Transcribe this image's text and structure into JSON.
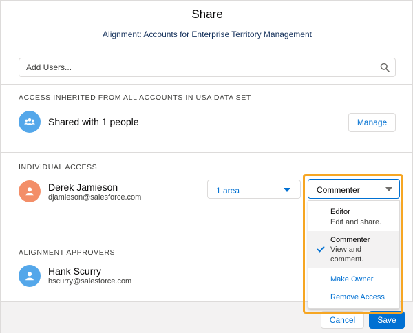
{
  "dialog": {
    "title": "Share",
    "subtitle": "Alignment: Accounts for Enterprise Territory Management"
  },
  "search": {
    "placeholder": "Add Users...",
    "icon": "search-icon"
  },
  "inherited": {
    "heading": "ACCESS INHERITED FROM ALL ACCOUNTS IN USA DATA SET",
    "label": "Shared with 1 people",
    "manage_label": "Manage",
    "avatar_color": "#54a7ea"
  },
  "individual": {
    "heading": "INDIVIDUAL ACCESS",
    "user": {
      "name": "Derek Jamieson",
      "email": "djamieson@salesforce.com",
      "avatar_color": "#f38e68"
    },
    "area_select": "1 area",
    "role_select": "Commenter"
  },
  "role_menu": {
    "options": [
      {
        "title": "Editor",
        "description": "Edit and share."
      },
      {
        "title": "Commenter",
        "description": "View and\ncomment.",
        "selected": true
      }
    ],
    "actions": [
      "Make Owner",
      "Remove Access"
    ]
  },
  "approvers": {
    "heading": "ALIGNMENT APPROVERS",
    "user": {
      "name": "Hank Scurry",
      "email": "hscurry@salesforce.com",
      "avatar_color": "#54a7ea"
    }
  },
  "footer": {
    "cancel_label": "Cancel",
    "save_label": "Save"
  },
  "colors": {
    "brand": "#0070d2",
    "highlight": "#f6a623"
  }
}
